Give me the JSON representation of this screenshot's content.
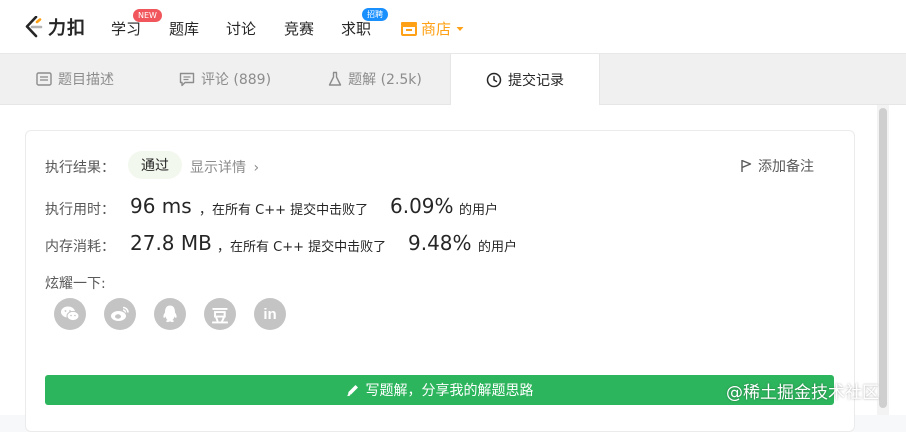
{
  "nav": {
    "logo_text": "力扣",
    "items": [
      {
        "label": "学习",
        "badge": "NEW"
      },
      {
        "label": "题库"
      },
      {
        "label": "讨论"
      },
      {
        "label": "竞赛"
      },
      {
        "label": "求职",
        "badge": "招聘"
      },
      {
        "label": "商店"
      }
    ],
    "colors": {
      "brand": "#ffa116",
      "new_badge": "#f0565b",
      "job_badge": "#1a90ff"
    }
  },
  "tabs": [
    {
      "label": "题目描述",
      "icon": "description-icon"
    },
    {
      "label": "评论 (889)",
      "icon": "comment-icon"
    },
    {
      "label": "题解 (2.5k)",
      "icon": "flask-icon"
    },
    {
      "label": "提交记录",
      "icon": "clock-icon",
      "active": true
    }
  ],
  "result": {
    "label": "执行结果：",
    "status": "通过",
    "detail": "显示详情",
    "add_note": "添加备注"
  },
  "runtime": {
    "label": "执行用时：",
    "value": "96 ms",
    "text": "，在所有 C++ 提交中击败了",
    "percent": "6.09%",
    "suffix": "的用户"
  },
  "memory": {
    "label": "内存消耗：",
    "value": "27.8 MB",
    "text": "，在所有 C++ 提交中击败了",
    "percent": "9.48%",
    "suffix": "的用户"
  },
  "share": {
    "label": "炫耀一下:",
    "icons": [
      "wechat-icon",
      "weibo-icon",
      "qq-icon",
      "douban-icon",
      "linkedin-icon"
    ],
    "douban_glyph": "豆",
    "linkedin_glyph": "in"
  },
  "write_solution": "写题解，分享我的解题思路",
  "watermark": "@稀土掘金技术社区",
  "colors": {
    "accent_green": "#2db55d",
    "pass_bg": "#f3f8ee"
  }
}
